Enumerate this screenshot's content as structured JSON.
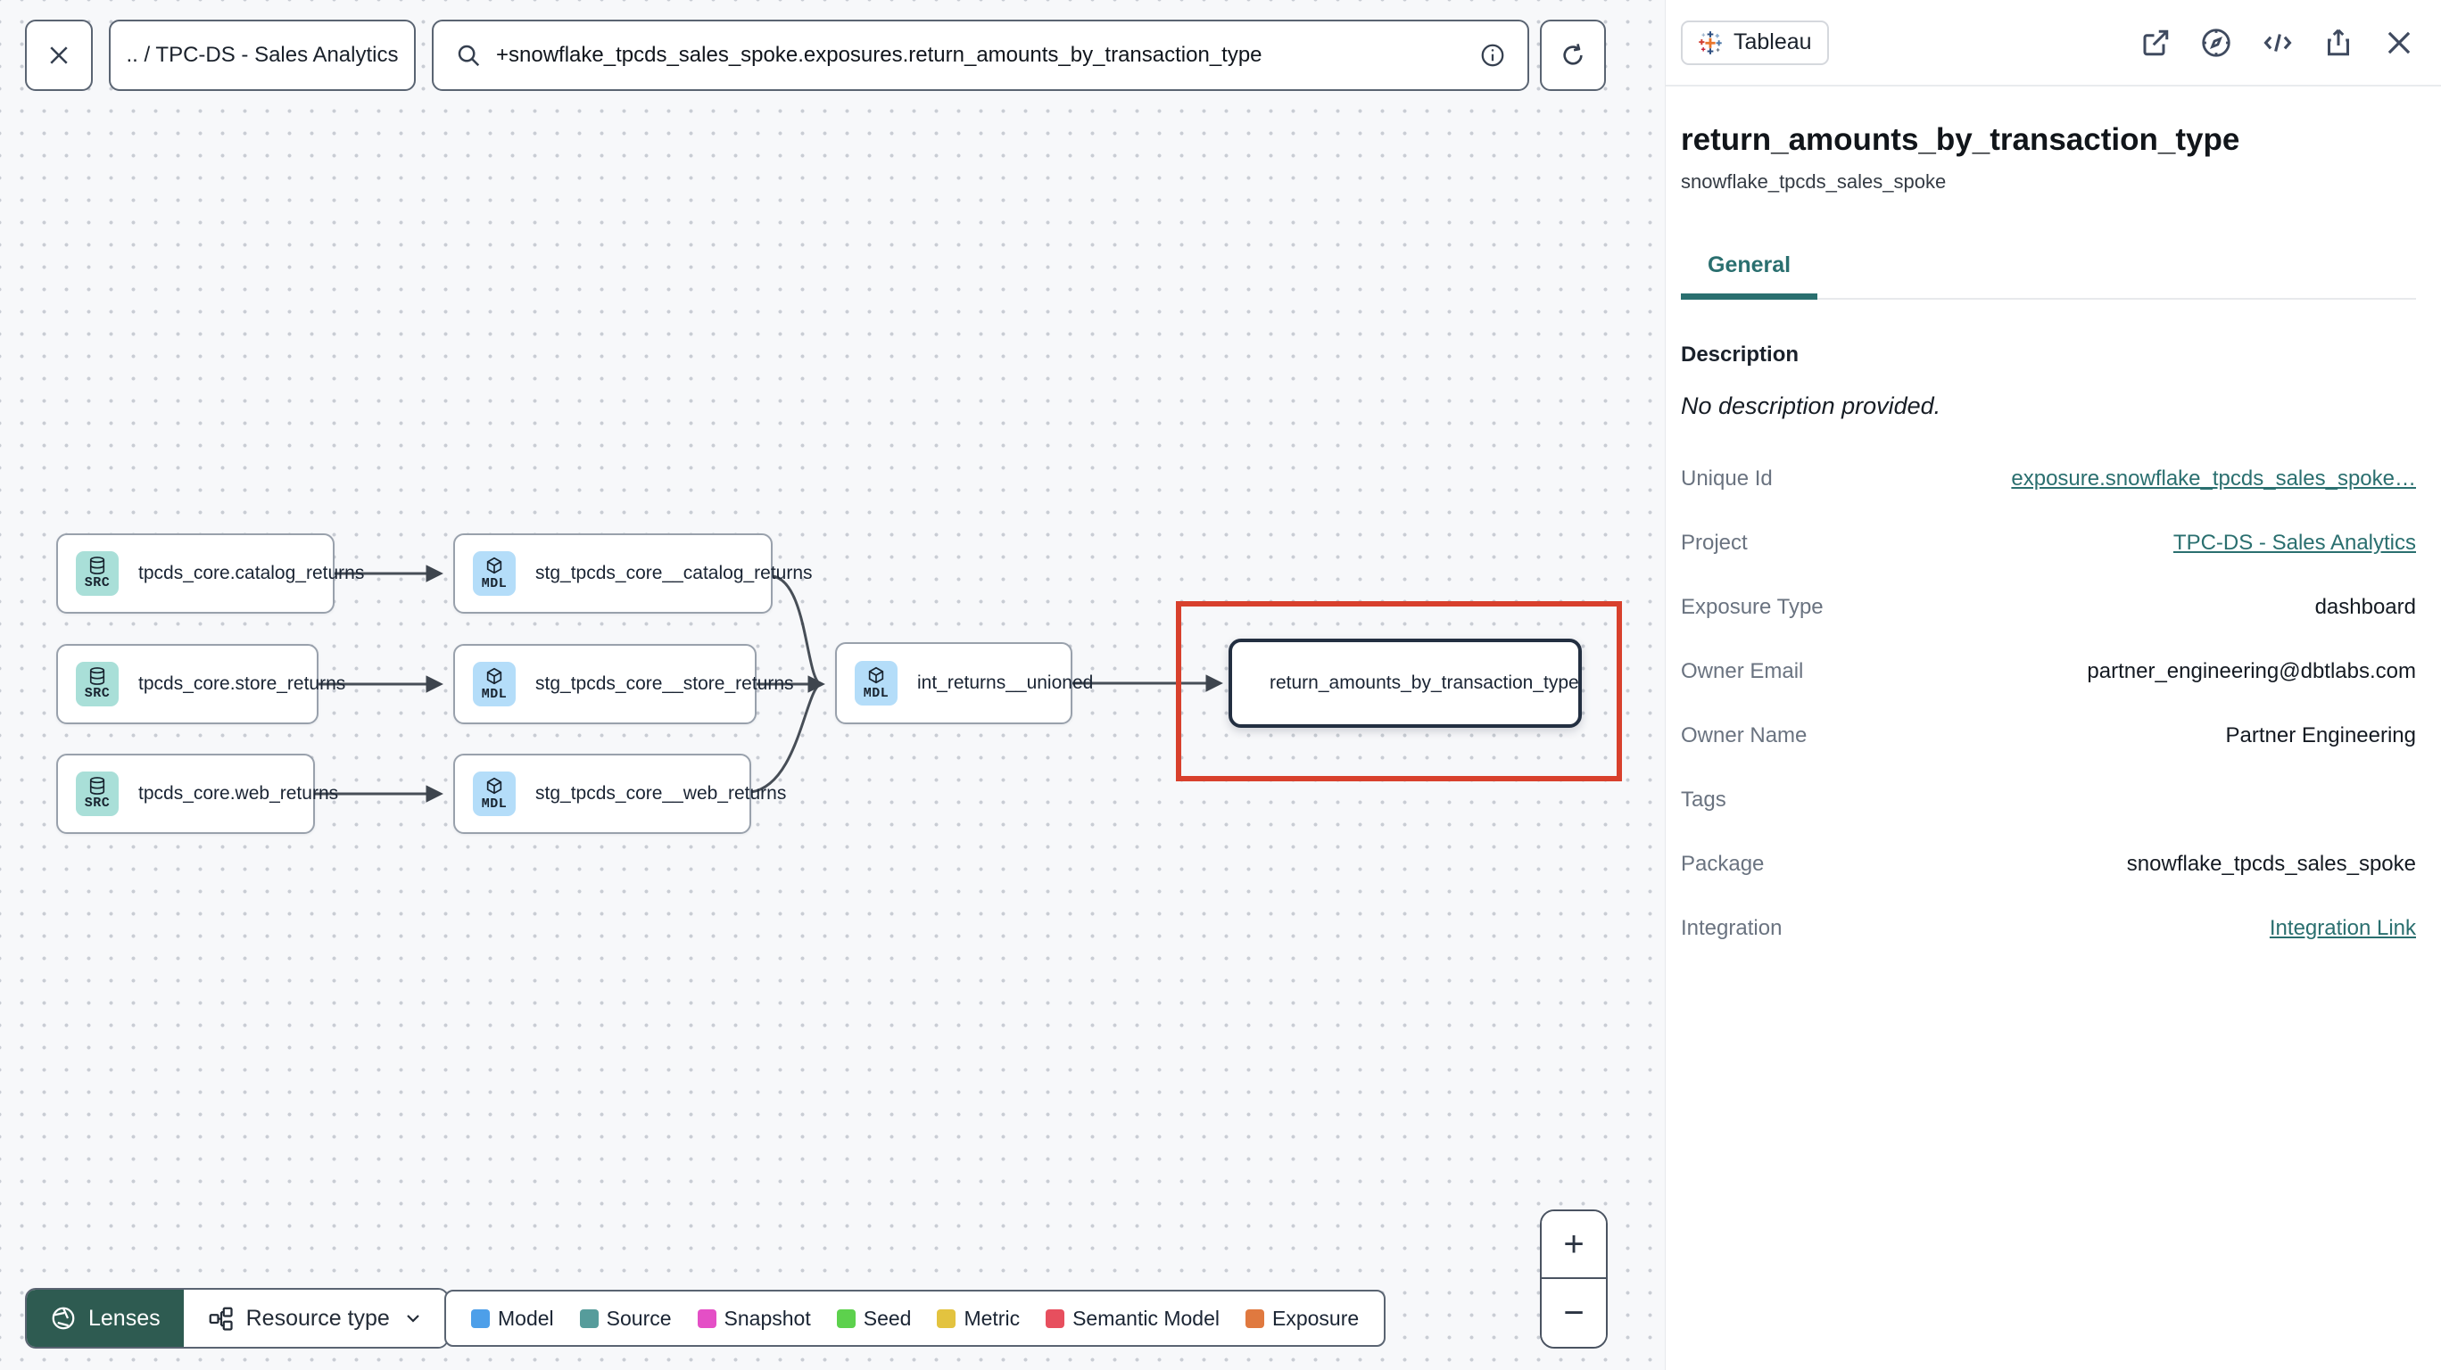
{
  "topbar": {
    "breadcrumb": ".. / TPC-DS - Sales Analytics",
    "search_value": "+snowflake_tpcds_sales_spoke.exposures.return_amounts_by_transaction_type"
  },
  "graph": {
    "nodes": [
      {
        "badge": "SRC",
        "label": "tpcds_core.catalog_returns"
      },
      {
        "badge": "MDL",
        "label": "stg_tpcds_core__catalog_returns"
      },
      {
        "badge": "SRC",
        "label": "tpcds_core.store_returns"
      },
      {
        "badge": "MDL",
        "label": "stg_tpcds_core__store_returns"
      },
      {
        "badge": "SRC",
        "label": "tpcds_core.web_returns"
      },
      {
        "badge": "MDL",
        "label": "stg_tpcds_core__web_returns"
      },
      {
        "badge": "MDL",
        "label": "int_returns__unioned"
      },
      {
        "badge": "tableau",
        "label": "return_amounts_by_transaction_type"
      }
    ]
  },
  "controls": {
    "lenses_label": "Lenses",
    "resource_type_label": "Resource type",
    "zoom_in": "+",
    "zoom_out": "−"
  },
  "legend": {
    "items": [
      {
        "label": "Model",
        "color": "#4D9FE9"
      },
      {
        "label": "Source",
        "color": "#569C9B"
      },
      {
        "label": "Snapshot",
        "color": "#E44FC6"
      },
      {
        "label": "Seed",
        "color": "#5DD14D"
      },
      {
        "label": "Metric",
        "color": "#E3C33F"
      },
      {
        "label": "Semantic Model",
        "color": "#E74F5E"
      },
      {
        "label": "Exposure",
        "color": "#E0793F"
      }
    ]
  },
  "panel": {
    "tool_badge": "Tableau",
    "title": "return_amounts_by_transaction_type",
    "subtitle": "snowflake_tpcds_sales_spoke",
    "tab": "General",
    "description_heading": "Description",
    "description_empty": "No description provided.",
    "rows": [
      {
        "label": "Unique Id",
        "value": "exposure.snowflake_tpcds_sales_spoke…"
      },
      {
        "label": "Project",
        "value": "TPC-DS - Sales Analytics"
      },
      {
        "label": "Exposure Type",
        "value": "dashboard"
      },
      {
        "label": "Owner Email",
        "value": "partner_engineering@dbtlabs.com"
      },
      {
        "label": "Owner Name",
        "value": "Partner Engineering"
      },
      {
        "label": "Tags",
        "value": ""
      },
      {
        "label": "Package",
        "value": "snowflake_tpcds_sales_spoke"
      },
      {
        "label": "Integration",
        "value": "Integration Link"
      }
    ]
  },
  "colors": {
    "accent_teal": "#2A6F6F",
    "highlight_red": "#D8402C",
    "lenses_green": "#2E5B51",
    "src_badge_bg": "#A9DFD8",
    "mdl_badge_bg": "#B4DDF9"
  }
}
